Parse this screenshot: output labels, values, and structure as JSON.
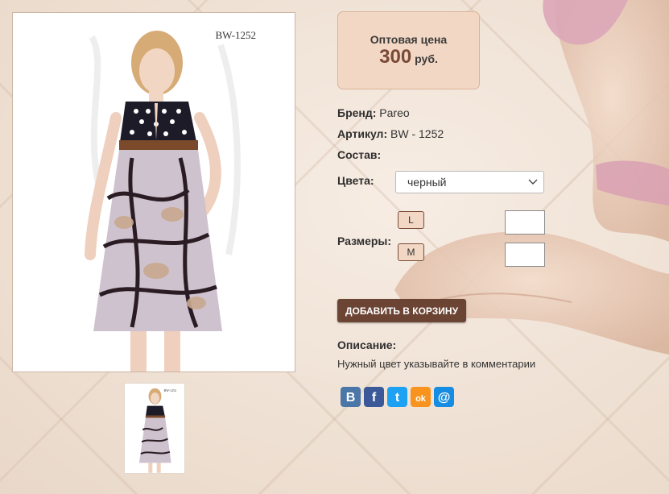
{
  "product": {
    "image_label": "BW-1252",
    "thumb_label": "BW-1252"
  },
  "price": {
    "title": "Оптовая цена",
    "value": "300",
    "currency": "руб."
  },
  "details": {
    "brand_label": "Бренд:",
    "brand_value": "Pareo",
    "article_label": "Артикул:",
    "article_value": "BW - 1252",
    "composition_label": "Состав:",
    "colors_label": "Цвета:",
    "color_selected": "черный",
    "sizes_label": "Размеры:",
    "sizes": [
      {
        "label": "L",
        "qty": ""
      },
      {
        "label": "M",
        "qty": ""
      }
    ]
  },
  "actions": {
    "add_to_cart": "ДОБАВИТЬ В КОРЗИНУ"
  },
  "description": {
    "label": "Описание:",
    "text": "Нужный цвет указывайте в комментарии"
  },
  "social": [
    {
      "name": "vk-icon",
      "glyph": "В",
      "color": "#4a76a8"
    },
    {
      "name": "facebook-icon",
      "glyph": "f",
      "color": "#3b5998"
    },
    {
      "name": "twitter-icon",
      "glyph": "t",
      "color": "#1da1f2"
    },
    {
      "name": "odnoklassniki-icon",
      "glyph": "ok",
      "color": "#f7931e"
    },
    {
      "name": "mail-icon",
      "glyph": "@",
      "color": "#168de2"
    }
  ]
}
